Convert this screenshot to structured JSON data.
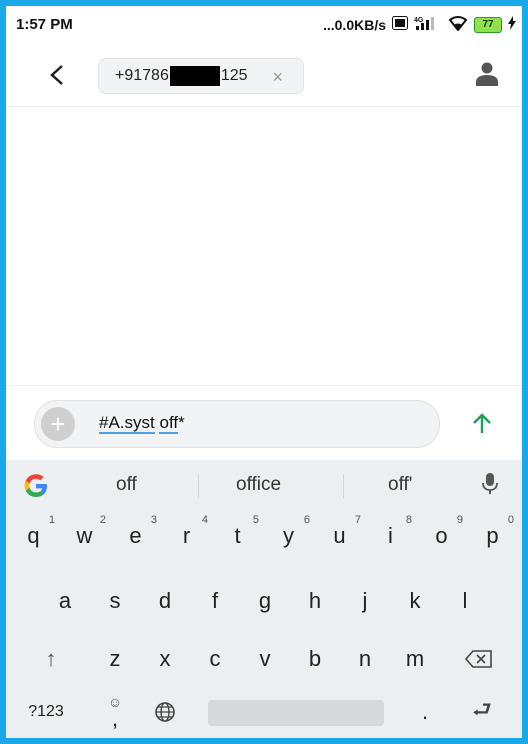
{
  "status": {
    "time": "1:57 PM",
    "speed": "...0.0KB/s",
    "network": "4G",
    "battery": "77"
  },
  "header": {
    "recipient_prefix": "+91786",
    "recipient_suffix": "125",
    "clear_glyph": "×"
  },
  "compose": {
    "add_glyph": "+",
    "word1": "#A.syst",
    "word2": "off",
    "tail": "*"
  },
  "keyboard": {
    "suggestions": [
      "off",
      "office",
      "off'"
    ],
    "row1": [
      {
        "k": "q",
        "h": "1"
      },
      {
        "k": "w",
        "h": "2"
      },
      {
        "k": "e",
        "h": "3"
      },
      {
        "k": "r",
        "h": "4"
      },
      {
        "k": "t",
        "h": "5"
      },
      {
        "k": "y",
        "h": "6"
      },
      {
        "k": "u",
        "h": "7"
      },
      {
        "k": "i",
        "h": "8"
      },
      {
        "k": "o",
        "h": "9"
      },
      {
        "k": "p",
        "h": "0"
      }
    ],
    "row2": [
      "a",
      "s",
      "d",
      "f",
      "g",
      "h",
      "j",
      "k",
      "l"
    ],
    "row3": [
      "z",
      "x",
      "c",
      "v",
      "b",
      "n",
      "m"
    ],
    "shift_glyph": "↑",
    "num_label": "?123",
    "emoji_glyph": "☺",
    "comma": ",",
    "period": ".",
    "enter_glyph": "⮐"
  },
  "colors": {
    "accent_send": "#1e9e55",
    "frame": "#19a9e8"
  }
}
